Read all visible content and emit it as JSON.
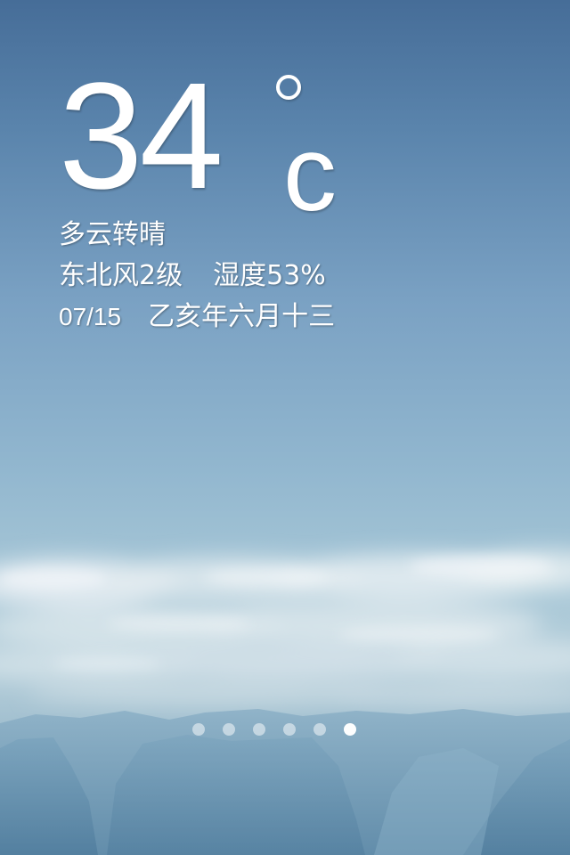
{
  "weather": {
    "temperature": "34",
    "unit": "c",
    "condition": "多云转晴",
    "wind": "东北风2级",
    "humidity": "湿度53%",
    "date": "07/15",
    "lunar_date": "乙亥年六月十三"
  },
  "pager": {
    "total_pages": 6,
    "active_index": 5
  },
  "colors": {
    "sky_top": "#466d98",
    "sky_mid": "#92b7cf",
    "cloud": "#e6eef2",
    "mountain": "#6f9ab7",
    "text": "#ffffff"
  },
  "icons": {
    "degree": "degree-icon"
  }
}
